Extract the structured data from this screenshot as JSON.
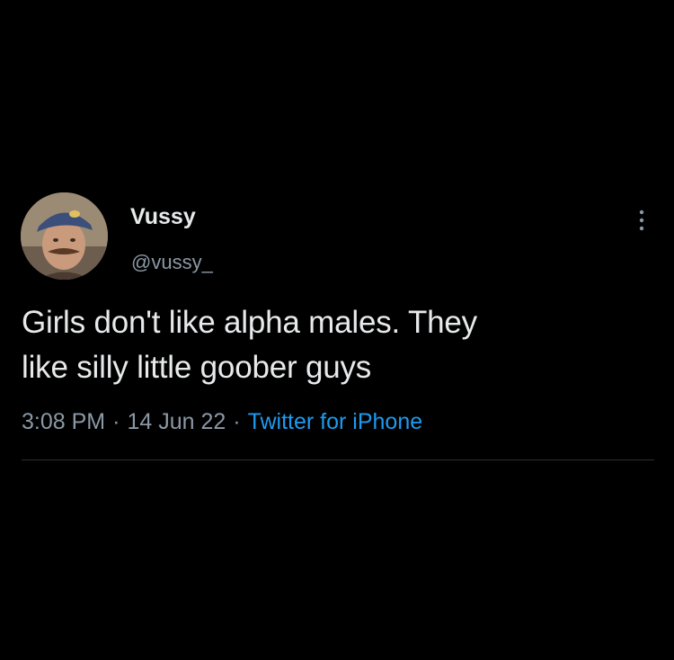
{
  "tweet": {
    "author": {
      "display_name": "Vussy",
      "handle": "@vussy_",
      "avatar_icon": "avatar-photo"
    },
    "more_icon": "more-vertical-icon",
    "text_line1": "Girls don't like alpha males. They",
    "text_line2": "like silly little goober guys",
    "time": "3:08 PM",
    "separator": "·",
    "date": "14 Jun 22",
    "source": "Twitter for iPhone"
  },
  "colors": {
    "background": "#000000",
    "text": "#e7e9ea",
    "secondary": "#8b98a5",
    "link": "#1d9bf0",
    "divider": "#2a2f33"
  }
}
